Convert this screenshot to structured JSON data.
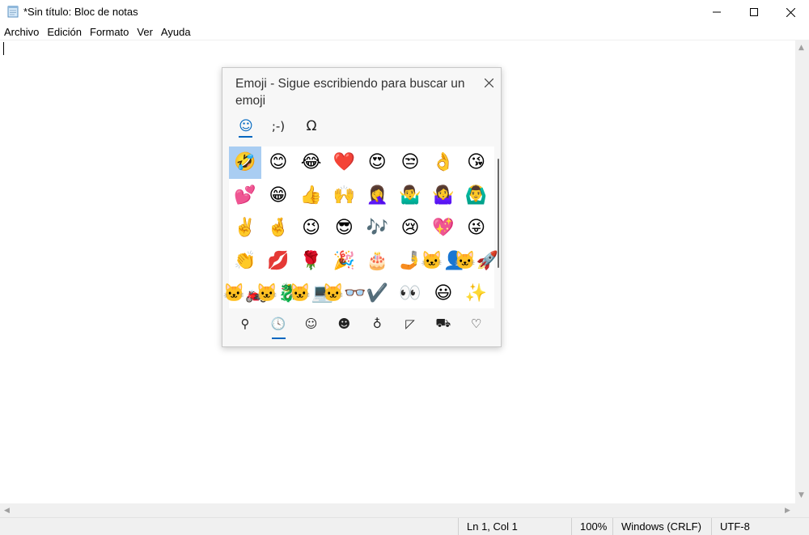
{
  "window": {
    "title": "*Sin título: Bloc de notas",
    "controls": [
      "minimize-icon",
      "maximize-icon",
      "close-icon"
    ]
  },
  "menu": [
    "Archivo",
    "Edición",
    "Formato",
    "Ver",
    "Ayuda"
  ],
  "editor": {
    "content": ""
  },
  "status": {
    "position": "Ln 1, Col 1",
    "zoom": "100%",
    "line_ending": "Windows (CRLF)",
    "encoding": "UTF-8"
  },
  "emoji_panel": {
    "title": "Emoji - Sigue escribiendo para buscar un emoji",
    "tabs": [
      {
        "symbol": "☺",
        "name": "emoji-tab-icon"
      },
      {
        "symbol": ";-)",
        "name": "kaomoji-tab-icon"
      },
      {
        "symbol": "Ω",
        "name": "symbols-tab-icon"
      }
    ],
    "active_tab": 0,
    "selected_index": 0,
    "emojis": [
      "🤣",
      "😊",
      "😂",
      "❤️",
      "😍",
      "😒",
      "👌",
      "😘",
      "💕",
      "😁",
      "👍",
      "🙌",
      "🤦‍♀️",
      "🤷‍♂️",
      "🤷‍♀️",
      "🙆‍♂️",
      "✌️",
      "🤞",
      "😉",
      "😎",
      "🎶",
      "😢",
      "💖",
      "😜",
      "👏",
      "💋",
      "🌹",
      "🎉",
      "🎂",
      "🤳",
      "🐱‍👤",
      "🐱‍🚀",
      "🐱‍🏍",
      "🐱‍🐉",
      "🐱‍💻",
      "🐱‍👓",
      "✔️",
      "👀",
      "😃",
      "✨"
    ],
    "categories": [
      {
        "symbol": "⚲",
        "name": "search-icon"
      },
      {
        "symbol": "🕓",
        "name": "recent-clock-icon"
      },
      {
        "symbol": "☺",
        "name": "smiley-category-icon"
      },
      {
        "symbol": "☻",
        "name": "people-category-icon"
      },
      {
        "symbol": "♁",
        "name": "celebration-balloon-icon"
      },
      {
        "symbol": "◸",
        "name": "food-category-icon"
      },
      {
        "symbol": "⛟",
        "name": "travel-car-icon"
      },
      {
        "symbol": "♡",
        "name": "heart-category-icon"
      }
    ],
    "active_category": 1
  }
}
